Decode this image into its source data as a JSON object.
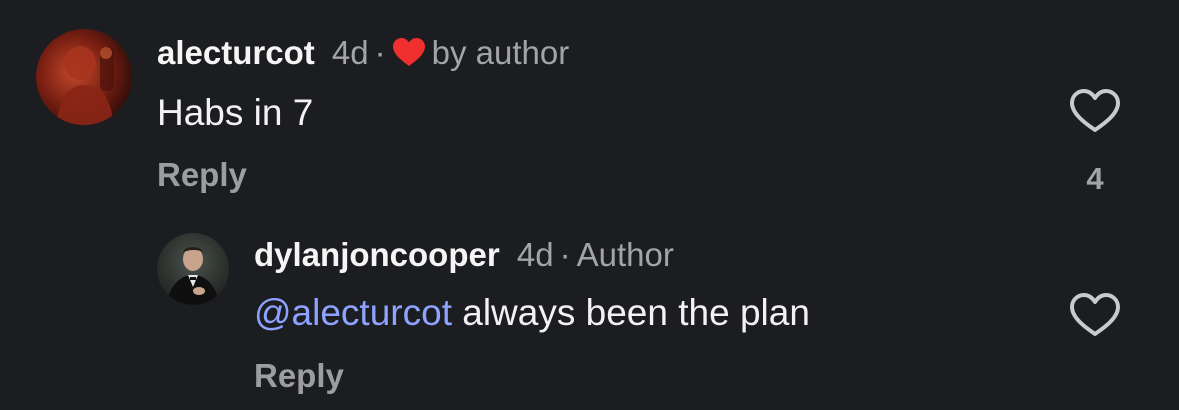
{
  "comments": [
    {
      "username": "alecturcot",
      "age": "4d",
      "separator": "·",
      "liked_by_author_label": "by author",
      "text": "Habs in 7",
      "reply_label": "Reply",
      "like_count": "4",
      "heart_color": "#f0302f"
    }
  ],
  "replies": [
    {
      "username": "dylanjoncooper",
      "age": "4d",
      "separator": "·",
      "role": "Author",
      "mention": "@alecturcot",
      "text": " always been the plan",
      "reply_label": "Reply"
    }
  ],
  "colors": {
    "background": "#1c1d20",
    "mention": "#8ea2ff",
    "secondary_text": "#a3a4a8"
  }
}
